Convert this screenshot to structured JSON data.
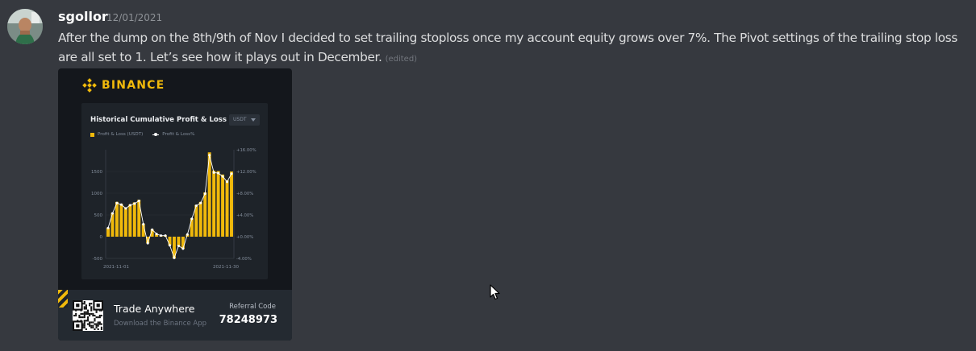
{
  "message": {
    "author": "sgollor",
    "timestamp": "12/01/2021",
    "text": "After the dump on the 8th/9th of Nov I decided to set trailing stoploss once my account equity grows over 7%. The Pivot settings of the trailing stop loss are all set to 1. Let’s see how it plays out in December.",
    "edited_label": "(edited)"
  },
  "attachment": {
    "brand": "BINANCE",
    "card_title": "Historical Cumulative Profit & Loss",
    "currency_select": "USDT",
    "legend_bar": "Profit & Loss (USDT)",
    "legend_line": "Profit & Loss%",
    "footer": {
      "title": "Trade Anywhere",
      "subtitle": "Download the Binance App",
      "referral_label": "Referral Code",
      "referral_code": "78248973"
    }
  },
  "chart_data": {
    "type": "bar",
    "series": [
      {
        "name": "Profit & Loss (USDT)",
        "color": "#f0b90b",
        "values": [
          200,
          550,
          800,
          760,
          660,
          740,
          790,
          850,
          300,
          -150,
          170,
          60,
          20,
          30,
          -200,
          -500,
          -220,
          -280,
          50,
          420,
          730,
          800,
          1020,
          1940,
          1520,
          1510,
          1430,
          1300,
          1500
        ]
      },
      {
        "name": "Profit & Loss%",
        "color": "#ffffff",
        "values": [
          1.6,
          4.3,
          6.2,
          5.9,
          5.2,
          5.8,
          6.1,
          6.6,
          2.3,
          -1.2,
          1.3,
          0.5,
          0.2,
          0.2,
          -1.6,
          -3.9,
          -1.7,
          -2.2,
          0.4,
          3.3,
          5.7,
          6.2,
          7.9,
          15.0,
          11.8,
          11.7,
          11.1,
          10.1,
          11.6
        ]
      }
    ],
    "x_start": "2021-11-01",
    "x_end": "2021-11-30",
    "y_ticks": [
      1500,
      1000,
      500,
      0,
      -500
    ],
    "y2_ticks": [
      "+16.00%",
      "+12.00%",
      "+8.00%",
      "+4.00%",
      "+0.00%",
      "-4.00%"
    ],
    "ylim": [
      -500,
      2000
    ],
    "y2lim": [
      -4,
      16
    ]
  }
}
